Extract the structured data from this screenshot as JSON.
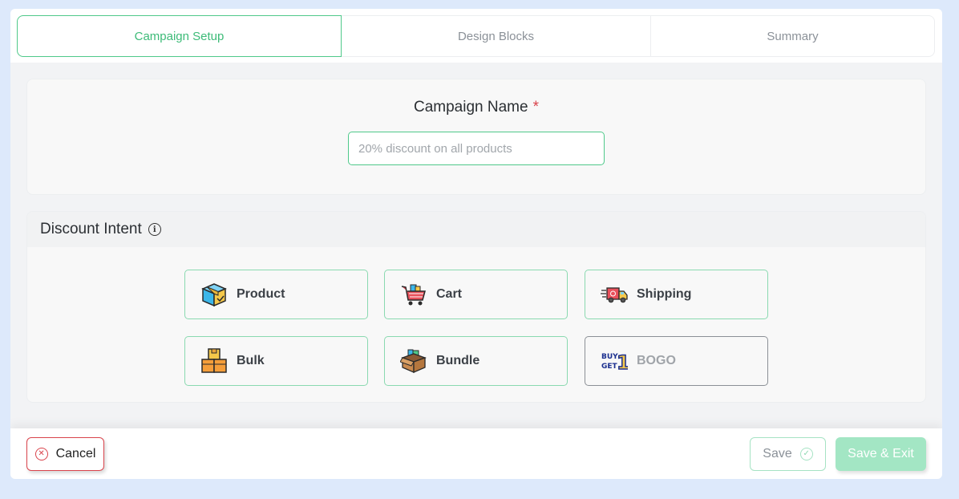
{
  "tabs": [
    {
      "label": "Campaign Setup",
      "active": true
    },
    {
      "label": "Design Blocks",
      "active": false
    },
    {
      "label": "Summary",
      "active": false
    }
  ],
  "campaign": {
    "label": "Campaign Name",
    "required_mark": "*",
    "placeholder": "20% discount on all products",
    "value": ""
  },
  "intent": {
    "title": "Discount Intent",
    "info_icon": "i",
    "options": [
      {
        "label": "Product",
        "icon": "box-icon",
        "disabled": false
      },
      {
        "label": "Cart",
        "icon": "cart-icon",
        "disabled": false
      },
      {
        "label": "Shipping",
        "icon": "truck-icon",
        "disabled": false
      },
      {
        "label": "Bulk",
        "icon": "stacked-boxes-icon",
        "disabled": false
      },
      {
        "label": "Bundle",
        "icon": "bundle-box-icon",
        "disabled": false
      },
      {
        "label": "BOGO",
        "icon": "buy1-get1-icon",
        "disabled": true
      }
    ]
  },
  "footer": {
    "cancel_label": "Cancel",
    "save_label": "Save",
    "save_exit_label": "Save & Exit"
  },
  "colors": {
    "accent": "#4fc98a",
    "danger": "#d9434b",
    "background": "#dde9fb",
    "save_exit_bg": "#a3e6c4"
  }
}
